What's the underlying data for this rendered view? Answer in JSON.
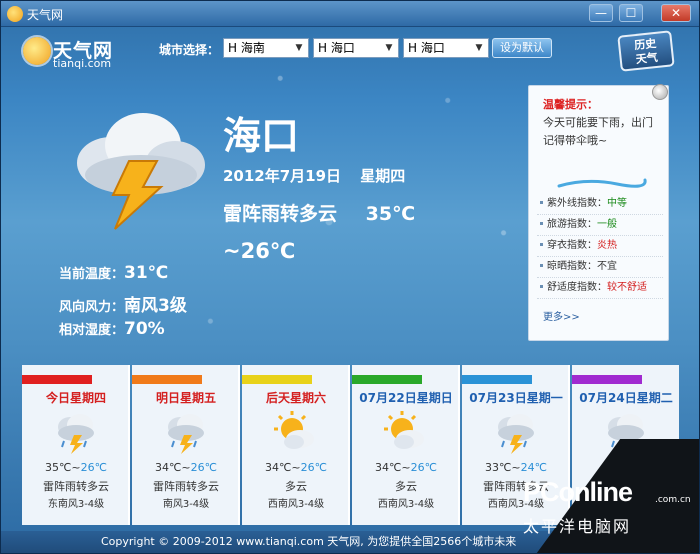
{
  "window": {
    "title": "天气网",
    "minimize": "—",
    "maximize": "☐",
    "close": "✕"
  },
  "logo": {
    "name": "天气网",
    "domain": "tianqi.com"
  },
  "city_selector": {
    "label": "城市选择：",
    "province": "H 海南",
    "city": "H 海口",
    "district": "H 海口",
    "default_button": "设为默认",
    "history_button_line1": "历史",
    "history_button_line2": "天气"
  },
  "current": {
    "city": "海口",
    "date": "2012年7月19日",
    "weekday": "星期四",
    "condition": "雷阵雨转多云",
    "high": "35℃",
    "low": "~26℃",
    "stats": [
      {
        "key": "当前温度：",
        "value": "31℃"
      },
      {
        "key": "风向风力：",
        "value": "南风3级"
      },
      {
        "key": "相对湿度：",
        "value": "70%"
      }
    ]
  },
  "tip": {
    "title": "温馨提示：",
    "text": "今天可能要下雨，出门记得带伞哦~",
    "indices": [
      {
        "name": "紫外线指数：",
        "value": "中等",
        "color": "#1a8a1a"
      },
      {
        "name": "旅游指数：",
        "value": "一般",
        "color": "#1a8a1a"
      },
      {
        "name": "穿衣指数：",
        "value": "炎热",
        "color": "#d42020"
      },
      {
        "name": "晾晒指数：",
        "value": "不宜",
        "color": "#333333"
      },
      {
        "name": "舒适度指数：",
        "value": "较不舒适",
        "color": "#d42020"
      }
    ],
    "more": "更多>>"
  },
  "forecast": [
    {
      "label": "今日星期四",
      "label_color": "#d42020",
      "bar_color": "#e02020",
      "icon": "thunder-rain-icon",
      "high": "35℃~",
      "low": "26℃",
      "condition": "雷阵雨转多云",
      "wind": "东南风3-4级"
    },
    {
      "label": "明日星期五",
      "label_color": "#d42020",
      "bar_color": "#f07a1a",
      "icon": "thunder-rain-icon",
      "high": "34℃~",
      "low": "26℃",
      "condition": "雷阵雨转多云",
      "wind": "南风3-4级"
    },
    {
      "label": "后天星期六",
      "label_color": "#d42020",
      "bar_color": "#e8d21a",
      "icon": "partly-cloudy-icon",
      "high": "34℃~",
      "low": "26℃",
      "condition": "多云",
      "wind": "西南风3-4级"
    },
    {
      "label": "07月22日星期日",
      "label_color": "#2060b0",
      "bar_color": "#2aa82a",
      "icon": "partly-cloudy-icon",
      "high": "34℃~",
      "low": "26℃",
      "condition": "多云",
      "wind": "西南风3-4级"
    },
    {
      "label": "07月23日星期一",
      "label_color": "#2060b0",
      "bar_color": "#2a92d6",
      "icon": "thunder-rain-icon",
      "high": "33℃~",
      "low": "24℃",
      "condition": "雷阵雨转多云",
      "wind": "西南风3-4级"
    },
    {
      "label": "07月24日星期二",
      "label_color": "#2060b0",
      "bar_color": "#a02ad0",
      "icon": "thunder-rain-icon",
      "high": "",
      "low": "",
      "condition": "",
      "wind": ""
    }
  ],
  "footer": "Copyright © 2009-2012 www.tianqi.com 天气网, 为您提供全国2566个城市未来",
  "watermark": {
    "brand": "PConline",
    "dotcom": ".com.cn",
    "cn": "太平洋电脑网"
  }
}
